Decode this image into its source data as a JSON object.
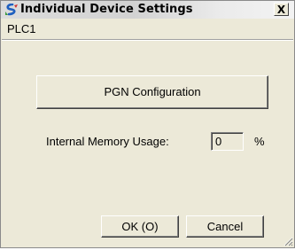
{
  "window": {
    "title": "Individual Device Settings",
    "close_label": "X",
    "app_icon": "app-logo-icon"
  },
  "device": {
    "name": "PLC1"
  },
  "pgn_button": {
    "label": "PGN Configuration"
  },
  "memory": {
    "label": "Internal Memory Usage:",
    "value": "0",
    "unit": "%"
  },
  "buttons": {
    "ok_label": "OK (O)",
    "cancel_label": "Cancel"
  },
  "colors": {
    "dialog_background": "#ece9d8",
    "icon_blue": "#1f5fbf",
    "icon_red": "#d03030"
  }
}
